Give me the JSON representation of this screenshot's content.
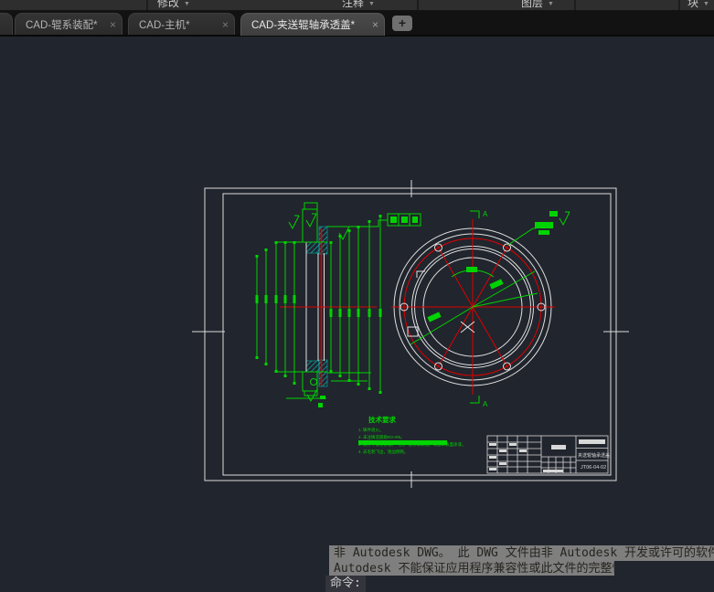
{
  "ribbon": {
    "panels": [
      {
        "label": "修改"
      },
      {
        "label": "注释"
      },
      {
        "label": "图层"
      },
      {
        "label": "块"
      }
    ],
    "caret": "▼"
  },
  "tabs": {
    "items": [
      {
        "label": "CAD-辊系装配*",
        "close": "×",
        "active": false
      },
      {
        "label": "CAD-主机*",
        "close": "×",
        "active": false
      },
      {
        "label": "CAD-夹送辊轴承透盖*",
        "close": "×",
        "active": true
      }
    ],
    "new_tab": "+"
  },
  "drawing": {
    "tech_requirements": {
      "title": "技术要求",
      "notes": [
        "1. 铸件退火。",
        "2. 未注铸造圆角R3~R5。",
        "3. 铸件不得有砂眼、气孔、裂纹等缺陷，非加工表面涂漆。",
        "4. 去毛刺飞边，锐边倒钝。"
      ]
    },
    "section_label": "A",
    "title_block": {
      "part_name": "夹送辊轴承透盖",
      "drawing_no": "JT06-04-02"
    },
    "colors": {
      "dimension_green": "#00d400",
      "centerline_red": "#e00000",
      "outline_white": "#e2e2e2",
      "hatch_cyan": "#00cccc"
    }
  },
  "command_line": {
    "history": [
      "非 Autodesk DWG。  此 DWG 文件由非 Autodesk 开发或许可的软件应用程序创建。",
      "Autodesk 不能保证应用程序兼容性或此文件的完整性。"
    ],
    "prompt": "命令:"
  }
}
